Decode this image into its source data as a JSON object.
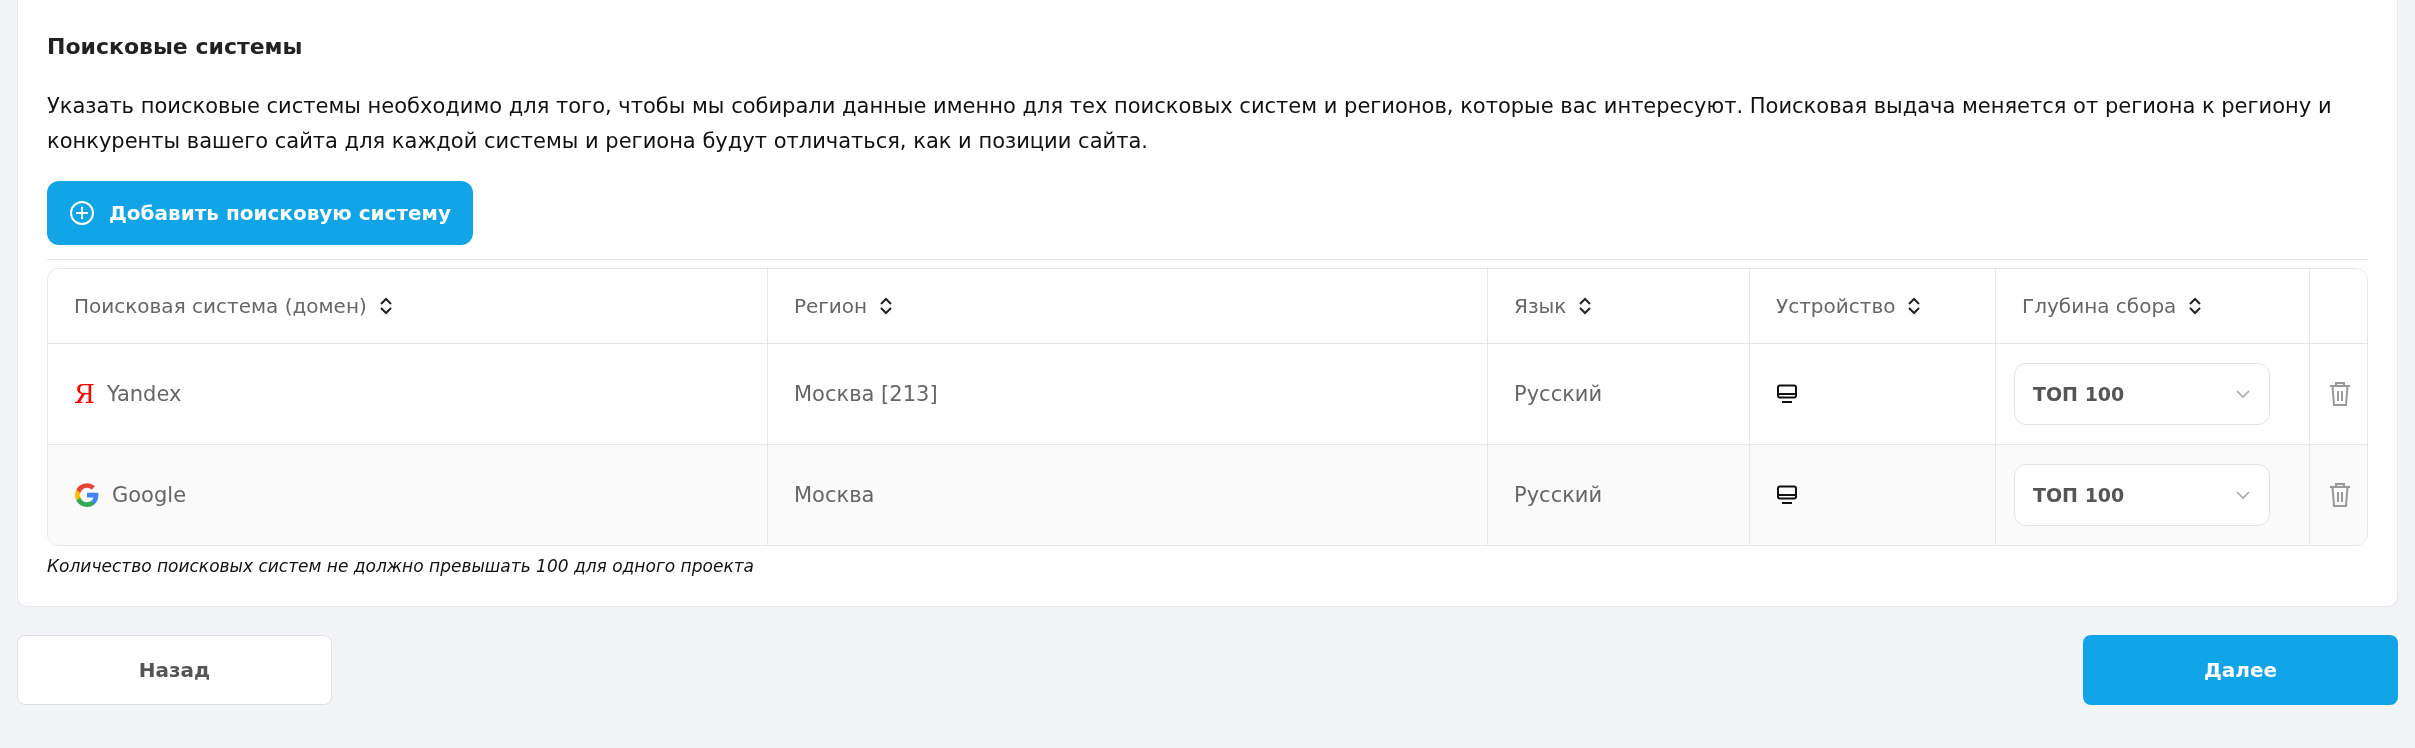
{
  "section": {
    "title": "Поисковые системы",
    "description": "Указать поисковые системы необходимо для того, чтобы мы собирали данные именно для тех поисковых систем и регионов, которые вас интересуют. Поисковая выдача меняется от региона к региону и конкуренты вашего сайта для каждой системы и региона будут отличаться, как и позиции сайта.",
    "add_button": "Добавить поисковую систему"
  },
  "table": {
    "columns": [
      "Поисковая система (домен)",
      "Регион",
      "Язык",
      "Устройство",
      "Глубина сбора"
    ],
    "rows": [
      {
        "logo": {
          "kind": "yandex",
          "glyph": "Я"
        },
        "engine": "Yandex",
        "region": "Москва [213]",
        "language": "Русский",
        "device": {
          "kind": "desktop"
        },
        "depth": "ТОП 100"
      },
      {
        "logo": {
          "kind": "google"
        },
        "engine": "Google",
        "region": "Москва",
        "language": "Русский",
        "device": {
          "kind": "desktop"
        },
        "depth": "ТОП 100"
      }
    ]
  },
  "note": "Количество поисковых систем не должно превышать 100 для одного проекта",
  "buttons": {
    "back": "Назад",
    "next": "Далее"
  }
}
